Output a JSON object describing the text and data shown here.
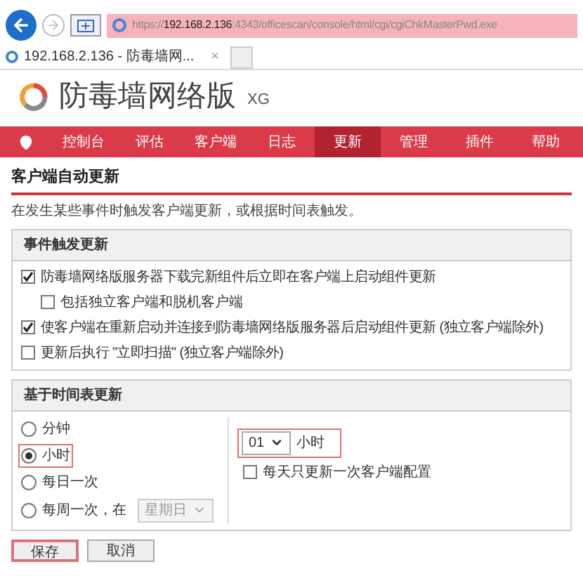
{
  "browser": {
    "url_prefix": "https://",
    "url_host": "192.168.2.136",
    "url_rest": ":4343/officescan/console/html/cgi/cgiChkMasterPwd.exe",
    "tab_title": "192.168.2.136 - 防毒墙网...",
    "tab_close": "×"
  },
  "logo": {
    "title": "防毒墙网络版",
    "suffix": "XG"
  },
  "nav": [
    {
      "label": "控制台",
      "selected": false
    },
    {
      "label": "评估",
      "selected": false
    },
    {
      "label": "客户端",
      "selected": false
    },
    {
      "label": "日志",
      "selected": false
    },
    {
      "label": "更新",
      "selected": true
    },
    {
      "label": "管理",
      "selected": false
    },
    {
      "label": "插件",
      "selected": false
    },
    {
      "label": "帮助",
      "selected": false
    }
  ],
  "page_title": "客户端自动更新",
  "description": "在发生某些事件时触发客户端更新，或根据时间表触发。",
  "event_section": {
    "title": "事件触发更新",
    "options": [
      {
        "label": "防毒墙网络版服务器下载完新组件后立即在客户端上启动组件更新",
        "checked": true,
        "children": [
          {
            "label": "包括独立客户端和脱机客户端",
            "checked": false
          }
        ]
      },
      {
        "label": "使客户端在重新启动并连接到防毒墙网络版服务器后启动组件更新 (独立客户端除外)",
        "checked": true
      },
      {
        "label": "更新后执行 \"立即扫描\" (独立客户端除外)",
        "checked": false
      }
    ]
  },
  "schedule_section": {
    "title": "基于时间表更新",
    "frequencies": [
      {
        "label": "分钟",
        "selected": false,
        "highlighted": false
      },
      {
        "label": "小时",
        "selected": true,
        "highlighted": true
      },
      {
        "label": "每日一次",
        "selected": false,
        "highlighted": false
      },
      {
        "label": "每周一次，在",
        "selected": false,
        "highlighted": false,
        "day_select": "星期日"
      }
    ],
    "interval": {
      "value": "01",
      "unit": "小时",
      "highlighted": true
    },
    "config_option": {
      "label": "每天只更新一次客户端配置",
      "checked": false
    }
  },
  "buttons": [
    {
      "label": "保存",
      "highlighted": true
    },
    {
      "label": "取消",
      "highlighted": false
    }
  ]
}
